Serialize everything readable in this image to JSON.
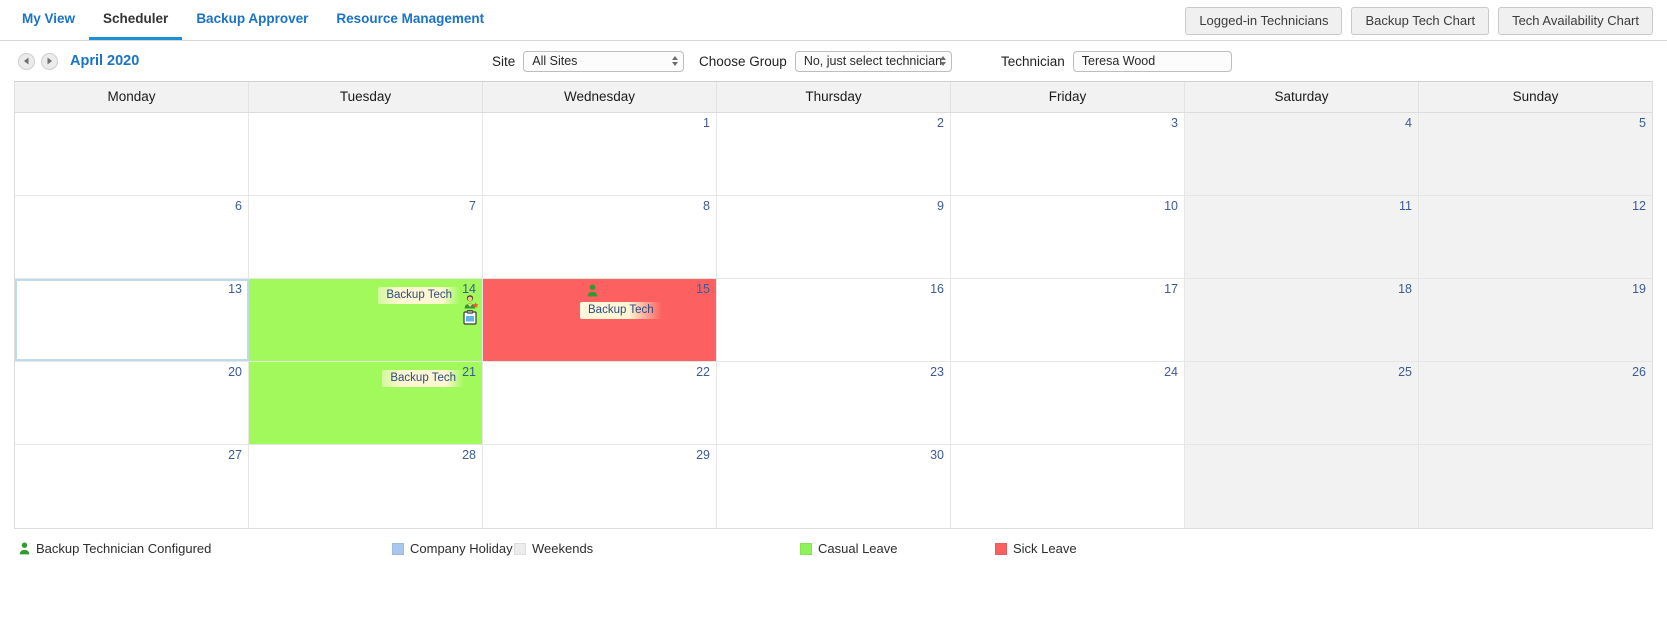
{
  "nav": {
    "tabs": [
      {
        "label": "My View",
        "active": false
      },
      {
        "label": "Scheduler",
        "active": true
      },
      {
        "label": "Backup Approver",
        "active": false
      },
      {
        "label": "Resource Management",
        "active": false
      }
    ],
    "actions": [
      {
        "label": "Logged-in Technicians"
      },
      {
        "label": "Backup Tech Chart"
      },
      {
        "label": "Tech Availability Chart"
      }
    ]
  },
  "filters": {
    "prev_icon": "chevron-left-icon",
    "next_icon": "chevron-right-icon",
    "month": "April 2020",
    "site": {
      "label": "Site",
      "value": "All Sites"
    },
    "group": {
      "label": "Choose Group",
      "value": "No, just select technician"
    },
    "technician": {
      "label": "Technician",
      "value": "Teresa Wood"
    }
  },
  "calendar": {
    "weekdays": [
      "Monday",
      "Tuesday",
      "Wednesday",
      "Thursday",
      "Friday",
      "Saturday",
      "Sunday"
    ],
    "weeks": [
      [
        {
          "day": "",
          "type": "empty"
        },
        {
          "day": "",
          "type": "empty"
        },
        {
          "day": "1",
          "type": "normal"
        },
        {
          "day": "2",
          "type": "normal"
        },
        {
          "day": "3",
          "type": "normal"
        },
        {
          "day": "4",
          "type": "weekend"
        },
        {
          "day": "5",
          "type": "weekend"
        }
      ],
      [
        {
          "day": "6",
          "type": "normal"
        },
        {
          "day": "7",
          "type": "normal"
        },
        {
          "day": "8",
          "type": "normal"
        },
        {
          "day": "9",
          "type": "normal"
        },
        {
          "day": "10",
          "type": "normal"
        },
        {
          "day": "11",
          "type": "weekend"
        },
        {
          "day": "12",
          "type": "weekend"
        }
      ],
      [
        {
          "day": "13",
          "type": "today"
        },
        {
          "day": "14",
          "type": "casual-leave",
          "chip": "Backup Tech"
        },
        {
          "day": "15",
          "type": "sick-leave",
          "chip": "Backup Tech"
        },
        {
          "day": "16",
          "type": "normal"
        },
        {
          "day": "17",
          "type": "normal"
        },
        {
          "day": "18",
          "type": "weekend"
        },
        {
          "day": "19",
          "type": "weekend"
        }
      ],
      [
        {
          "day": "20",
          "type": "normal"
        },
        {
          "day": "21",
          "type": "casual-leave",
          "chip": "Backup Tech"
        },
        {
          "day": "22",
          "type": "normal"
        },
        {
          "day": "23",
          "type": "normal"
        },
        {
          "day": "24",
          "type": "normal"
        },
        {
          "day": "25",
          "type": "weekend"
        },
        {
          "day": "26",
          "type": "weekend"
        }
      ],
      [
        {
          "day": "27",
          "type": "normal"
        },
        {
          "day": "28",
          "type": "normal"
        },
        {
          "day": "29",
          "type": "normal"
        },
        {
          "day": "30",
          "type": "normal"
        },
        {
          "day": "",
          "type": "empty"
        },
        {
          "day": "",
          "type": "weekend"
        },
        {
          "day": "",
          "type": "weekend"
        }
      ]
    ]
  },
  "legend": {
    "backup": "Backup Technician Configured",
    "holiday": "Company Holiday",
    "weekends": "Weekends",
    "casual": "Casual Leave",
    "sick": "Sick Leave"
  },
  "colors": {
    "accent_blue": "#1a73c7",
    "active_tab_underline": "#1b8fd4",
    "casual_leave": "#a1f95c",
    "sick_leave": "#fc6060",
    "company_holiday": "#a9c6ef",
    "weekend": "#ececec",
    "backup_green": "#2f9b2f",
    "chip_yellow": "#fdf6d2",
    "day_number": "#3c5a99",
    "today_border": "#bcdcec"
  }
}
